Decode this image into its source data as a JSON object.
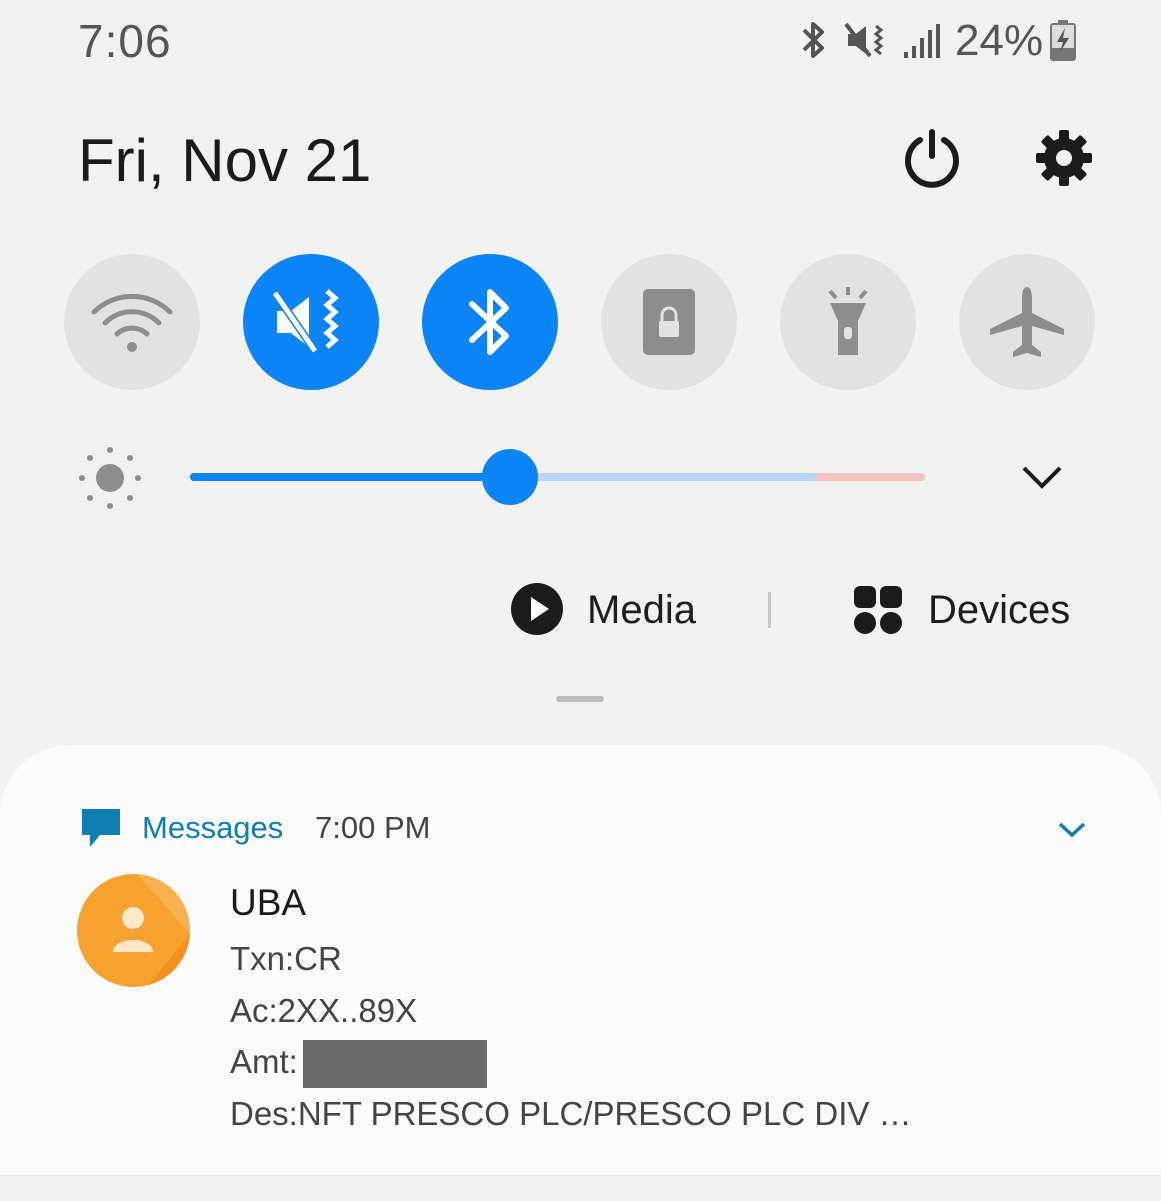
{
  "status_bar": {
    "time": "7:06",
    "battery": "24%",
    "icons": [
      "bluetooth-icon",
      "mute-vibrate-icon",
      "signal-icon",
      "battery-charging-icon"
    ]
  },
  "header": {
    "date": "Fri, Nov 21",
    "icons": [
      "power-icon",
      "settings-gear-icon"
    ]
  },
  "quick_settings": [
    {
      "name": "wifi",
      "icon": "wifi-icon",
      "active": false
    },
    {
      "name": "sound",
      "icon": "mute-vibrate-icon",
      "active": true
    },
    {
      "name": "bluetooth",
      "icon": "bluetooth-icon",
      "active": true
    },
    {
      "name": "rotation-lock",
      "icon": "lock-icon",
      "active": false
    },
    {
      "name": "flashlight",
      "icon": "flashlight-icon",
      "active": false
    },
    {
      "name": "airplane",
      "icon": "airplane-icon",
      "active": false
    }
  ],
  "brightness": {
    "level": 0.435,
    "icon": "sun-icon",
    "expand_icon": "chevron-down-icon"
  },
  "shortcuts": {
    "media": "Media",
    "devices": "Devices"
  },
  "colors": {
    "accent": "#0a84f7",
    "app": "#0e7fb0",
    "avatar": "#f7a12e"
  },
  "notification": {
    "app": "Messages",
    "time": "7:00 PM",
    "sender": "UBA",
    "lines": {
      "txn": "Txn:CR",
      "ac": "Ac:2XX..89X",
      "amt": "Amt:",
      "des": "Des:NFT PRESCO PLC/PRESCO PLC DIV …"
    }
  }
}
